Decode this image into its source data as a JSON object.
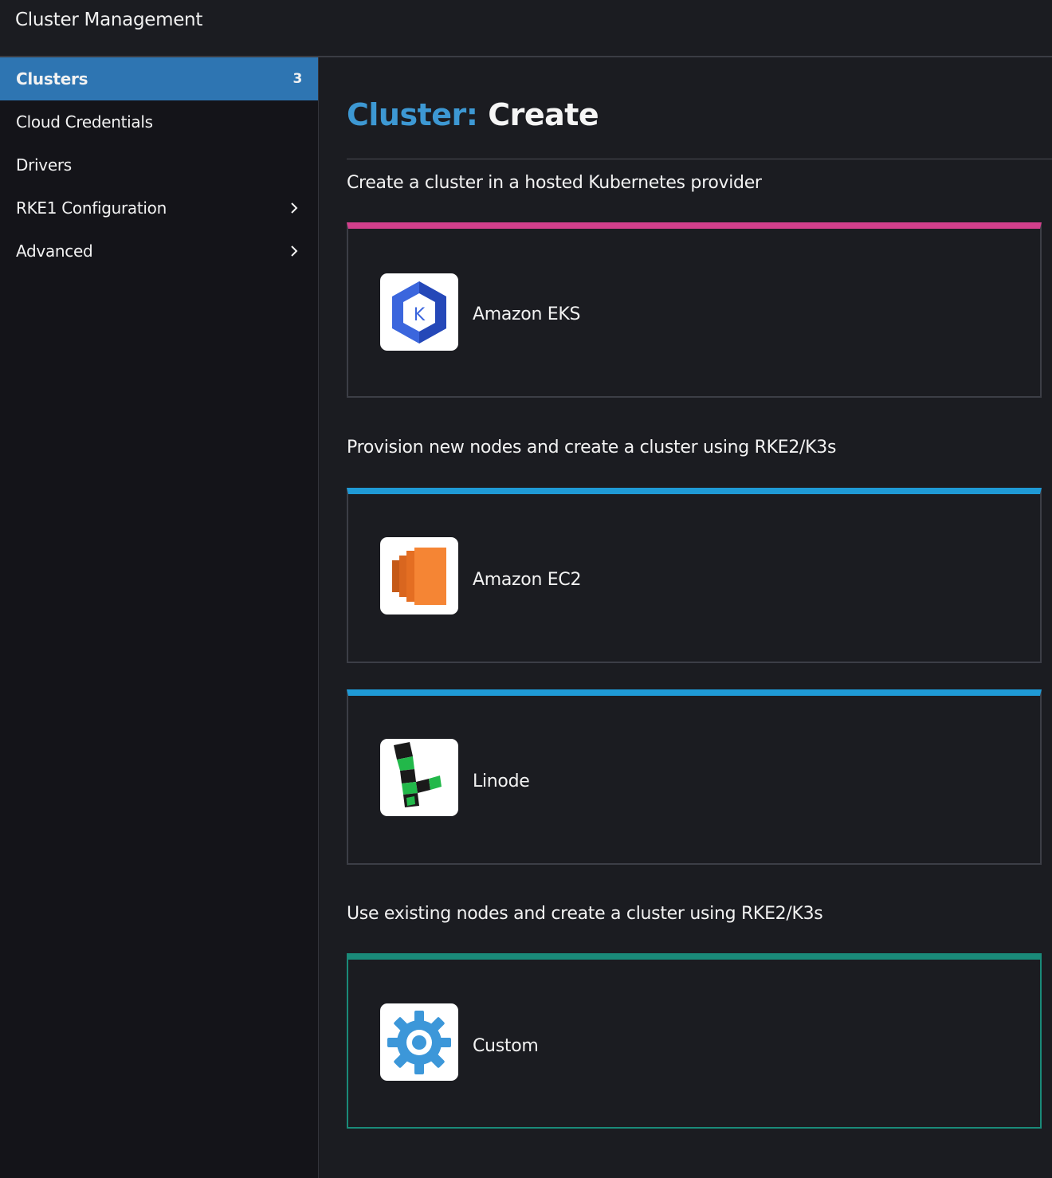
{
  "header": {
    "title": "Cluster Management"
  },
  "sidebar": {
    "items": [
      {
        "label": "Clusters",
        "count": "3",
        "active": true
      },
      {
        "label": "Cloud Credentials"
      },
      {
        "label": "Drivers"
      },
      {
        "label": "RKE1 Configuration",
        "icon": "chevron-right-icon"
      },
      {
        "label": "Advanced",
        "icon": "chevron-right-icon"
      }
    ]
  },
  "main": {
    "title_prefix": "Cluster:",
    "title": "Create",
    "sections": [
      {
        "label": "Create a cluster in a hosted Kubernetes provider",
        "cards": [
          {
            "name": "Amazon EKS",
            "icon": "amazon-eks-icon",
            "accent": "#d23f8c"
          }
        ]
      },
      {
        "label": "Provision new nodes and create a cluster using RKE2/K3s",
        "cards": [
          {
            "name": "Amazon EC2",
            "icon": "amazon-ec2-icon",
            "accent": "#1f9ad6"
          },
          {
            "name": "Linode",
            "icon": "linode-icon",
            "accent": "#1f9ad6"
          }
        ]
      },
      {
        "label": "Use existing nodes and create a cluster using RKE2/K3s",
        "cards": [
          {
            "name": "Custom",
            "icon": "gear-icon",
            "accent": "#1a8a79"
          }
        ]
      }
    ]
  },
  "colors": {
    "accent": "#2e75b2",
    "title_prefix": "#3d98d3",
    "background": "#1b1c21",
    "sidebar": "#141419"
  }
}
